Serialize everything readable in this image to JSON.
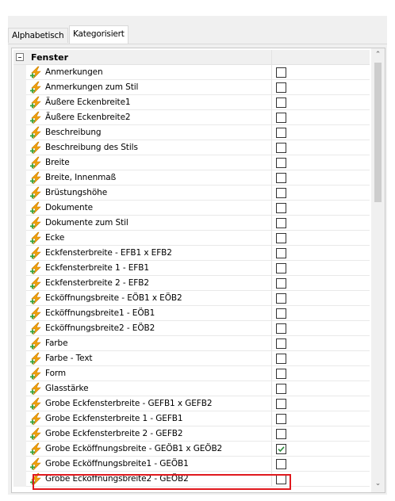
{
  "tabs": [
    {
      "label": "Alphabetisch",
      "active": false
    },
    {
      "label": "Kategorisiert",
      "active": true
    }
  ],
  "category": {
    "name": "Fenster",
    "expanded": true
  },
  "properties": [
    {
      "name": "Anmerkungen",
      "checked": false
    },
    {
      "name": "Anmerkungen zum Stil",
      "checked": false
    },
    {
      "name": "Äußere Eckenbreite1",
      "checked": false
    },
    {
      "name": "Äußere Eckenbreite2",
      "checked": false
    },
    {
      "name": "Beschreibung",
      "checked": false
    },
    {
      "name": "Beschreibung des Stils",
      "checked": false
    },
    {
      "name": "Breite",
      "checked": false
    },
    {
      "name": "Breite, Innenmaß",
      "checked": false
    },
    {
      "name": "Brüstungshöhe",
      "checked": false
    },
    {
      "name": "Dokumente",
      "checked": false
    },
    {
      "name": "Dokumente zum Stil",
      "checked": false
    },
    {
      "name": "Ecke",
      "checked": false
    },
    {
      "name": "Eckfensterbreite - EFB1 x EFB2",
      "checked": false
    },
    {
      "name": "Eckfensterbreite 1 - EFB1",
      "checked": false
    },
    {
      "name": "Eckfensterbreite 2 - EFB2",
      "checked": false
    },
    {
      "name": "Ecköffnungsbreite - EÖB1 x EÖB2",
      "checked": false
    },
    {
      "name": "Ecköffnungsbreite1 - EÖB1",
      "checked": false
    },
    {
      "name": "Ecköffnungsbreite2 - EÖB2",
      "checked": false
    },
    {
      "name": "Farbe",
      "checked": false
    },
    {
      "name": "Farbe - Text",
      "checked": false
    },
    {
      "name": "Form",
      "checked": false
    },
    {
      "name": "Glasstärke",
      "checked": false
    },
    {
      "name": "Grobe Eckfensterbreite - GEFB1 x GEFB2",
      "checked": false
    },
    {
      "name": "Grobe Eckfensterbreite 1 - GEFB1",
      "checked": false
    },
    {
      "name": "Grobe Eckfensterbreite 2 - GEFB2",
      "checked": false
    },
    {
      "name": "Grobe Ecköffnungsbreite - GEÖB1 x GEÖB2",
      "checked": true,
      "highlighted": true
    },
    {
      "name": "Grobe Ecköffnungsbreite1 - GEÖB1",
      "checked": false
    },
    {
      "name": "Grobe Ecköffnungsbreite2 - GEÖB2",
      "checked": false
    }
  ],
  "scrollbar": {
    "up_arrow": "⌃",
    "down_arrow": "⌄",
    "thumb_position": 0.0
  },
  "colors": {
    "highlight_border": "#e0191e",
    "check_mark": "#2a8a3a",
    "icon_bolt": "#f2a20c",
    "icon_plus": "#3aa33a"
  },
  "icons": {
    "property": "lightning-plus-icon",
    "collapse": "collapse-minus-icon",
    "check": "check-mark-icon"
  }
}
